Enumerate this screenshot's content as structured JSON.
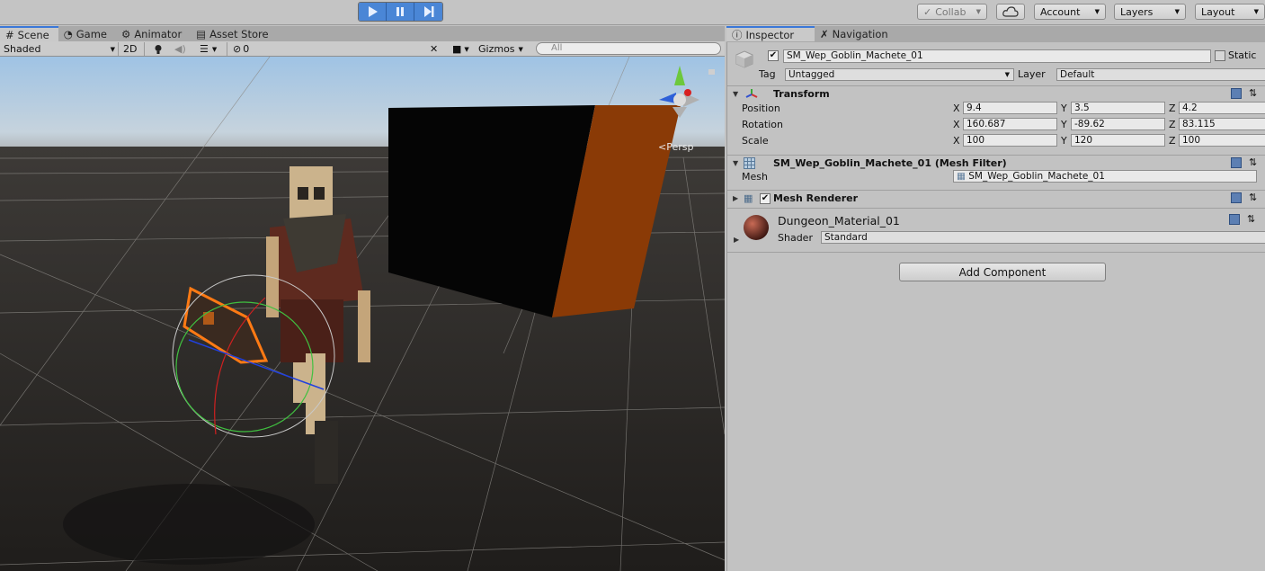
{
  "toolbar": {
    "collab_label": "Collab",
    "account_label": "Account",
    "layers_label": "Layers",
    "layout_label": "Layout"
  },
  "scene_tabs": [
    {
      "label": "Scene",
      "icon": "grid-icon"
    },
    {
      "label": "Game",
      "icon": "pacman-icon"
    },
    {
      "label": "Animator",
      "icon": "animator-icon"
    },
    {
      "label": "Asset Store",
      "icon": "store-icon"
    }
  ],
  "scene_bar": {
    "draw_mode": "Shaded",
    "mode_2d": "2D",
    "hidden_count": "0",
    "gizmos_label": "Gizmos",
    "search_placeholder": "All"
  },
  "viewport": {
    "persp_label": "Persp"
  },
  "inspector_tabs": [
    {
      "label": "Inspector",
      "icon": "info-icon"
    },
    {
      "label": "Navigation",
      "icon": "navigation-icon"
    }
  ],
  "inspector": {
    "object_name": "SM_Wep_Goblin_Machete_01",
    "static_label": "Static",
    "tag_label": "Tag",
    "tag_value": "Untagged",
    "layer_label": "Layer",
    "layer_value": "Default",
    "transform": {
      "title": "Transform",
      "position_label": "Position",
      "rotation_label": "Rotation",
      "scale_label": "Scale",
      "position": {
        "x": "9.4",
        "y": "3.5",
        "z": "4.2"
      },
      "rotation": {
        "x": "160.687",
        "y": "-89.62",
        "z": "83.115"
      },
      "scale": {
        "x": "100",
        "y": "120",
        "z": "100"
      },
      "axis_x": "X",
      "axis_y": "Y",
      "axis_z": "Z"
    },
    "mesh_filter": {
      "title": "SM_Wep_Goblin_Machete_01 (Mesh Filter)",
      "mesh_label": "Mesh",
      "mesh_value": "SM_Wep_Goblin_Machete_01"
    },
    "mesh_renderer": {
      "title": "Mesh Renderer"
    },
    "material": {
      "name": "Dungeon_Material_01",
      "shader_label": "Shader",
      "shader_value": "Standard"
    },
    "add_component_label": "Add Component"
  },
  "colors": {
    "accent": "#3b78d8",
    "selection_outline": "#ff7a14",
    "cube_side": "#8a3a06"
  }
}
